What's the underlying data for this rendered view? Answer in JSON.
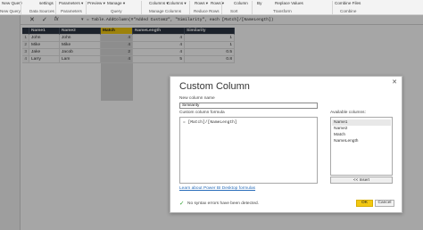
{
  "ribbon": {
    "items": [
      {
        "id": "new-query",
        "label": "Query"
      },
      {
        "id": "data-sources",
        "label": "Data Sources"
      },
      {
        "id": "settings",
        "label": "settings"
      },
      {
        "id": "parameters-top",
        "label": "Parameters ▾"
      },
      {
        "id": "parameters",
        "label": "Parameters"
      },
      {
        "id": "preview",
        "label": "Preview ▾"
      },
      {
        "id": "manage",
        "label": "Manage ▾"
      },
      {
        "id": "columns",
        "label": "Columns ▾"
      },
      {
        "id": "columns2",
        "label": "Columns ▾"
      },
      {
        "id": "rows",
        "label": "Rows ▾"
      },
      {
        "id": "rows2",
        "label": "Rows ▾"
      },
      {
        "id": "column",
        "label": "Column"
      },
      {
        "id": "by",
        "label": "By"
      },
      {
        "id": "replace-values",
        "label": "Replace Values"
      },
      {
        "id": "combine-files",
        "label": "Combine Files"
      }
    ],
    "groups": [
      {
        "id": "new-query",
        "label": "New Query"
      },
      {
        "id": "data-sources",
        "label": "Data Sources"
      },
      {
        "id": "parameters",
        "label": "Parameters"
      },
      {
        "id": "query",
        "label": "Query"
      },
      {
        "id": "manage-columns",
        "label": "Manage Columns"
      },
      {
        "id": "reduce-rows",
        "label": "Reduce Rows"
      },
      {
        "id": "sort",
        "label": "Sort"
      },
      {
        "id": "transform",
        "label": "Transform"
      },
      {
        "id": "combine",
        "label": "Combine"
      }
    ]
  },
  "formula_bar": {
    "cancel_icon": "✕",
    "confirm_icon": "✓",
    "fx": "fx",
    "formula": "= Table.AddColumn(#\"Added Custom2\", \"Similarity\", each [Match]/[NameLength])"
  },
  "grid": {
    "headers": [
      "",
      "Name1",
      "Name2",
      "Match",
      "NameLength",
      "Similarity"
    ],
    "rows": [
      [
        "1",
        "John",
        "John",
        "4",
        "4",
        "1"
      ],
      [
        "2",
        "Mike",
        "Mike",
        "4",
        "4",
        "1"
      ],
      [
        "3",
        "Jake",
        "Jacob",
        "2",
        "4",
        "0.5"
      ],
      [
        "4",
        "Larry",
        "Lam",
        "4",
        "5",
        "0.8"
      ]
    ]
  },
  "dialog": {
    "title": "Custom Column",
    "close_icon": "✕",
    "name_label": "New column name",
    "name_value": "Similarity",
    "formula_label": "Custom column formula",
    "formula_value": "= [Match]/[NameLength]",
    "available_label": "Available columns:",
    "available_columns": [
      "Name1",
      "Name2",
      "Match",
      "NameLength"
    ],
    "insert_label": "<< Insert",
    "learn_link": "Learn about Power BI Desktop formulas",
    "status_icon": "✓",
    "status_text": "No syntax errors have been detected.",
    "ok_label": "OK",
    "cancel_label": "Cancel"
  },
  "colors": {
    "header_bg": "#2b3542",
    "selected_header": "#f2c811",
    "ok_button": "#f2c811",
    "check_green": "#2a9d2a",
    "link_blue": "#2a6ebb"
  }
}
